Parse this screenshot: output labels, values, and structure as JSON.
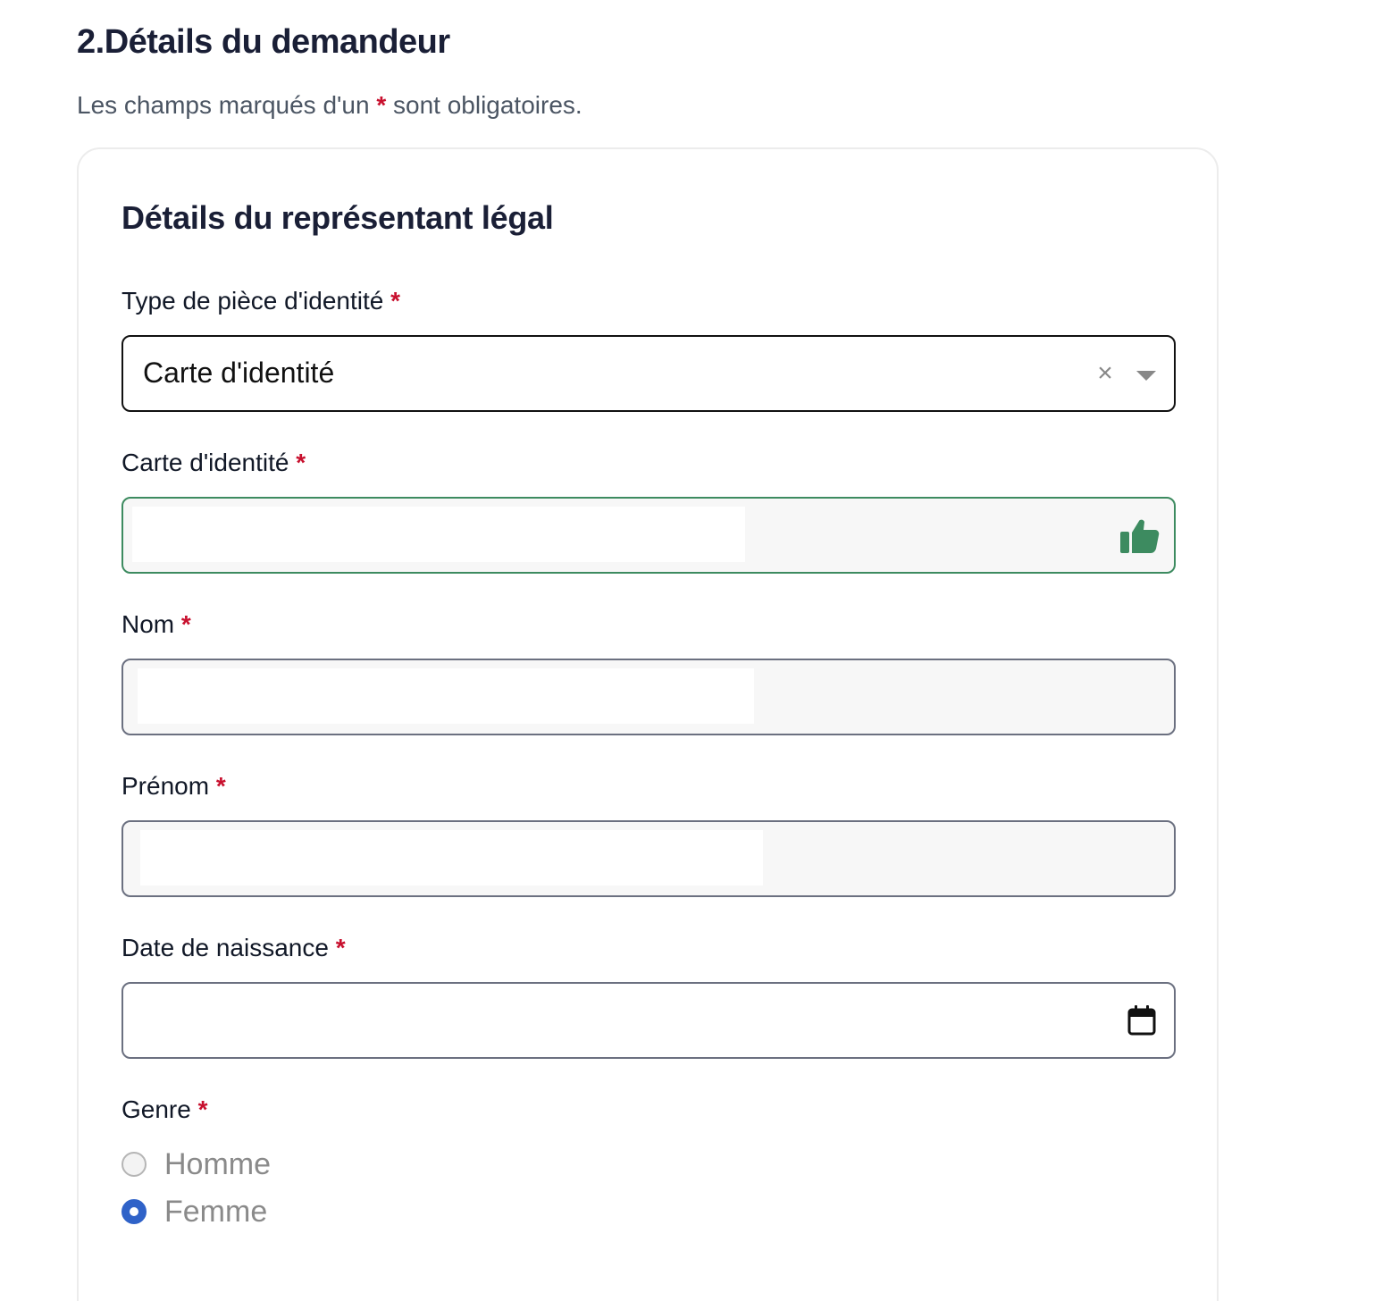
{
  "section": {
    "title": "2.Détails du demandeur",
    "hint_before": "Les champs marqués d'un",
    "hint_star": "*",
    "hint_after": "sont obligatoires."
  },
  "card": {
    "title": "Détails du représentant légal"
  },
  "fields": {
    "id_type": {
      "label": "Type de pièce d'identité",
      "required": "*",
      "value": "Carte d'identité",
      "clear_glyph": "×"
    },
    "id_card": {
      "label": "Carte d'identité",
      "required": "*",
      "value": ""
    },
    "last_name": {
      "label": "Nom",
      "required": "*",
      "value": ""
    },
    "first_name": {
      "label": "Prénom",
      "required": "*",
      "value": ""
    },
    "birth_date": {
      "label": "Date de naissance",
      "required": "*",
      "value": ""
    },
    "gender": {
      "label": "Genre",
      "required": "*",
      "options": [
        {
          "label": "Homme",
          "checked": false
        },
        {
          "label": "Femme",
          "checked": true
        }
      ]
    }
  },
  "colors": {
    "required_star": "#c8102e",
    "success_green": "#3d8b60",
    "radio_checked": "#2f62c8"
  },
  "icons": {
    "clear": "close-icon",
    "dropdown": "chevron-down-icon",
    "upload_status": "thumbs-up-icon",
    "date_picker": "calendar-icon"
  }
}
